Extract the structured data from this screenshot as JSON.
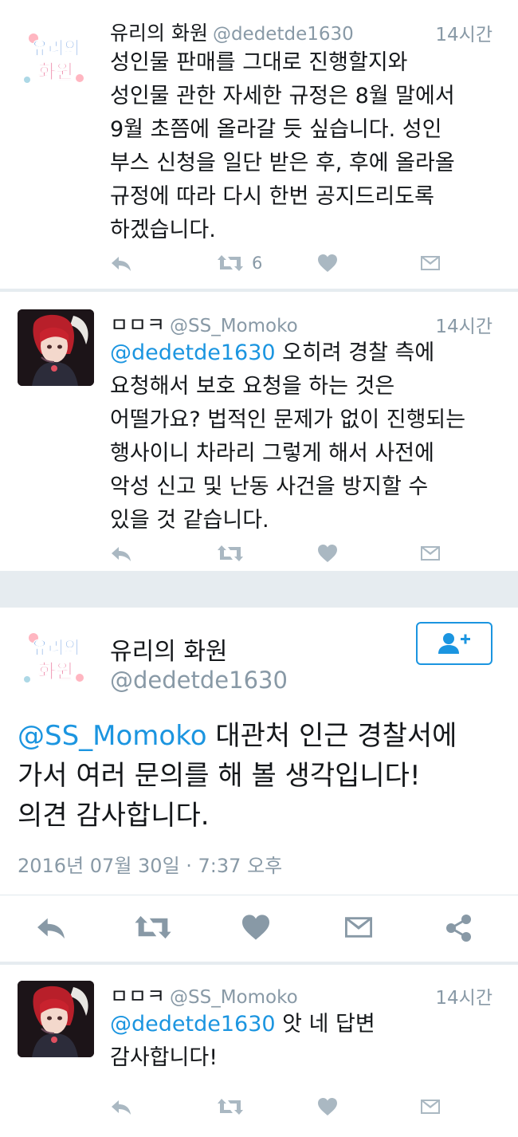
{
  "tweets": [
    {
      "name": "유리의 화원",
      "handle": "@dedetde1630",
      "time": "14시간",
      "mention": "",
      "body": "성인물 판매를 그대로 진행할지와\n성인물 관한 자세한 규정은 8월 말에서\n9월 초쯤에 올라갈 듯 싶습니다. 성인\n부스 신청을 일단 받은 후, 후에 올라올\n규정에 따라 다시 한번 공지드리도록\n하겠습니다.",
      "retweet_count": "6"
    },
    {
      "name": "ㅁㅁㅋ",
      "handle": "@SS_Momoko",
      "time": "14시간",
      "mention": "@dedetde1630",
      "body": " 오히려 경찰 측에\n요청해서 보호 요청을 하는 것은\n어떨가요? 법적인 문제가 없이 진행되는\n행사이니 차라리 그렇게 해서 사전에\n악성 신고 및 난동 사건을 방지할 수\n있을 것 같습니다.",
      "retweet_count": ""
    },
    {
      "name": "ㅁㅁㅋ",
      "handle": "@SS_Momoko",
      "time": "14시간",
      "mention": "@dedetde1630",
      "body": " 앗 네 답변\n감사합니다!",
      "retweet_count": ""
    }
  ],
  "main_tweet": {
    "name": "유리의 화원",
    "handle": "@dedetde1630",
    "mention": "@SS_Momoko",
    "body": " 대관처 인근 경찰서에\n가서 여러 문의를 해 볼 생각입니다!\n의견 감사합니다.",
    "date": "2016년 07월 30일 · 7:37 오후"
  },
  "avatars": {
    "yuri_logo_line1": "유리의",
    "yuri_logo_line2": "화원"
  },
  "colors": {
    "background": "#e6ecf0",
    "card": "#ffffff",
    "link_blue": "#1b95e0",
    "gray_text": "#8899a6",
    "icon_gray": "#aab8c2"
  },
  "icons": [
    "reply-icon",
    "retweet-icon",
    "heart-icon",
    "direct-message-icon",
    "share-icon",
    "follow-icon"
  ]
}
